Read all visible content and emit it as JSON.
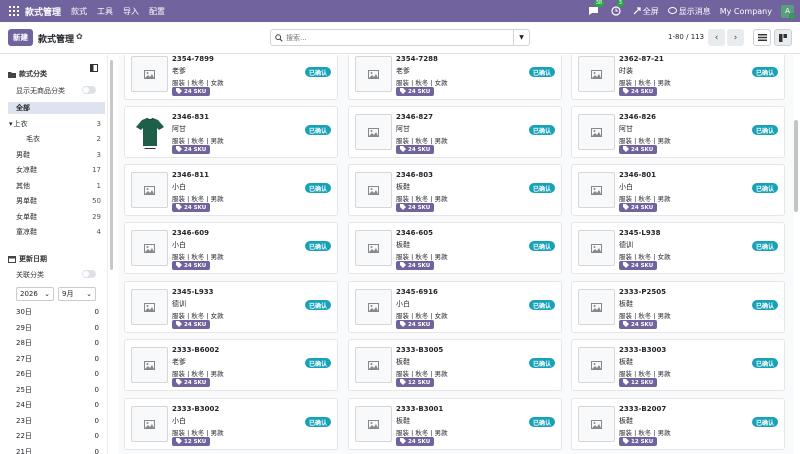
{
  "app": {
    "title": "款式管理",
    "menu": [
      "款式",
      "工具",
      "导入",
      "配置"
    ],
    "chat_badge": "38",
    "activity_badge": "3",
    "fullscreen": "全屏",
    "messages": "显示消息",
    "company": "My Company",
    "avatar_letter": "A"
  },
  "control": {
    "new_label": "新建",
    "page_title": "款式管理",
    "search_placeholder": "搜索...",
    "pager": "1-80 / 113"
  },
  "sidebar": {
    "category_title": "款式分类",
    "show_empty_label": "显示无商品分类",
    "categories": [
      {
        "label": "全部",
        "count": "",
        "active": true,
        "caret": false
      },
      {
        "label": "上衣",
        "count": "3",
        "active": false,
        "caret": true
      },
      {
        "label": "毛衣",
        "count": "2",
        "active": false,
        "caret": false,
        "child": true
      },
      {
        "label": "男鞋",
        "count": "3",
        "active": false,
        "caret": false
      },
      {
        "label": "女凉鞋",
        "count": "17",
        "active": false,
        "caret": false
      },
      {
        "label": "其他",
        "count": "1",
        "active": false,
        "caret": false
      },
      {
        "label": "男单鞋",
        "count": "50",
        "active": false,
        "caret": false
      },
      {
        "label": "女单鞋",
        "count": "29",
        "active": false,
        "caret": false
      },
      {
        "label": "童凉鞋",
        "count": "4",
        "active": false,
        "caret": false
      }
    ],
    "date_title": "更新日期",
    "related_label": "关联分类",
    "year": "2026",
    "month": "9月",
    "days": [
      {
        "label": "30日",
        "count": "0"
      },
      {
        "label": "29日",
        "count": "0"
      },
      {
        "label": "28日",
        "count": "0"
      },
      {
        "label": "27日",
        "count": "0"
      },
      {
        "label": "26日",
        "count": "0"
      },
      {
        "label": "25日",
        "count": "0"
      },
      {
        "label": "24日",
        "count": "0"
      },
      {
        "label": "23日",
        "count": "0"
      },
      {
        "label": "22日",
        "count": "0"
      },
      {
        "label": "21日",
        "count": "0"
      }
    ]
  },
  "cards": [
    {
      "code": "2354-7899",
      "name": "老爹",
      "tags": "服装 | 秋冬 | 女款",
      "sku": "24 SKU",
      "status": "已确认",
      "photo": false
    },
    {
      "code": "2354-7288",
      "name": "老爹",
      "tags": "服装 | 秋冬 | 女款",
      "sku": "24 SKU",
      "status": "已确认",
      "photo": false
    },
    {
      "code": "2362-87-21",
      "name": "时装",
      "tags": "服装 | 秋冬 | 男款",
      "sku": "24 SKU",
      "status": "已确认",
      "photo": false
    },
    {
      "code": "2346-831",
      "name": "阿甘",
      "tags": "服装 | 秋冬 | 男款",
      "sku": "24 SKU",
      "status": "已确认",
      "photo": true
    },
    {
      "code": "2346-827",
      "name": "阿甘",
      "tags": "服装 | 秋冬 | 男款",
      "sku": "24 SKU",
      "status": "已确认",
      "photo": false
    },
    {
      "code": "2346-826",
      "name": "阿甘",
      "tags": "服装 | 秋冬 | 男款",
      "sku": "24 SKU",
      "status": "已确认",
      "photo": false
    },
    {
      "code": "2346-811",
      "name": "小白",
      "tags": "服装 | 秋冬 | 男款",
      "sku": "24 SKU",
      "status": "已确认",
      "photo": false
    },
    {
      "code": "2346-803",
      "name": "板鞋",
      "tags": "服装 | 秋冬 | 男款",
      "sku": "24 SKU",
      "status": "已确认",
      "photo": false
    },
    {
      "code": "2346-801",
      "name": "小白",
      "tags": "服装 | 秋冬 | 男款",
      "sku": "24 SKU",
      "status": "已确认",
      "photo": false
    },
    {
      "code": "2346-609",
      "name": "小白",
      "tags": "服装 | 秋冬 | 男款",
      "sku": "24 SKU",
      "status": "已确认",
      "photo": false
    },
    {
      "code": "2346-605",
      "name": "板鞋",
      "tags": "服装 | 秋冬 | 男款",
      "sku": "24 SKU",
      "status": "已确认",
      "photo": false
    },
    {
      "code": "2345-L938",
      "name": "德训",
      "tags": "服装 | 秋冬 | 女款",
      "sku": "24 SKU",
      "status": "已确认",
      "photo": false
    },
    {
      "code": "2345-L933",
      "name": "德训",
      "tags": "服装 | 秋冬 | 女款",
      "sku": "24 SKU",
      "status": "已确认",
      "photo": false
    },
    {
      "code": "2345-6916",
      "name": "小白",
      "tags": "服装 | 秋冬 | 女款",
      "sku": "24 SKU",
      "status": "已确认",
      "photo": false
    },
    {
      "code": "2333-P2505",
      "name": "板鞋",
      "tags": "服装 | 秋冬 | 男款",
      "sku": "24 SKU",
      "status": "已确认",
      "photo": false
    },
    {
      "code": "2333-B6002",
      "name": "老爹",
      "tags": "服装 | 秋冬 | 男款",
      "sku": "24 SKU",
      "status": "已确认",
      "photo": false
    },
    {
      "code": "2333-B3005",
      "name": "板鞋",
      "tags": "服装 | 秋冬 | 男款",
      "sku": "12 SKU",
      "status": "已确认",
      "photo": false
    },
    {
      "code": "2333-B3003",
      "name": "板鞋",
      "tags": "服装 | 秋冬 | 男款",
      "sku": "12 SKU",
      "status": "已确认",
      "photo": false
    },
    {
      "code": "2333-B3002",
      "name": "小白",
      "tags": "服装 | 秋冬 | 男款",
      "sku": "12 SKU",
      "status": "已确认",
      "photo": false
    },
    {
      "code": "2333-B3001",
      "name": "板鞋",
      "tags": "服装 | 秋冬 | 男款",
      "sku": "24 SKU",
      "status": "已确认",
      "photo": false
    },
    {
      "code": "2333-B2007",
      "name": "板鞋",
      "tags": "服装 | 秋冬 | 男款",
      "sku": "12 SKU",
      "status": "已确认",
      "photo": false
    }
  ],
  "colors": {
    "brand": "#71639e",
    "status": "#17a2b8",
    "sidebar_active": "#dde4f0"
  }
}
